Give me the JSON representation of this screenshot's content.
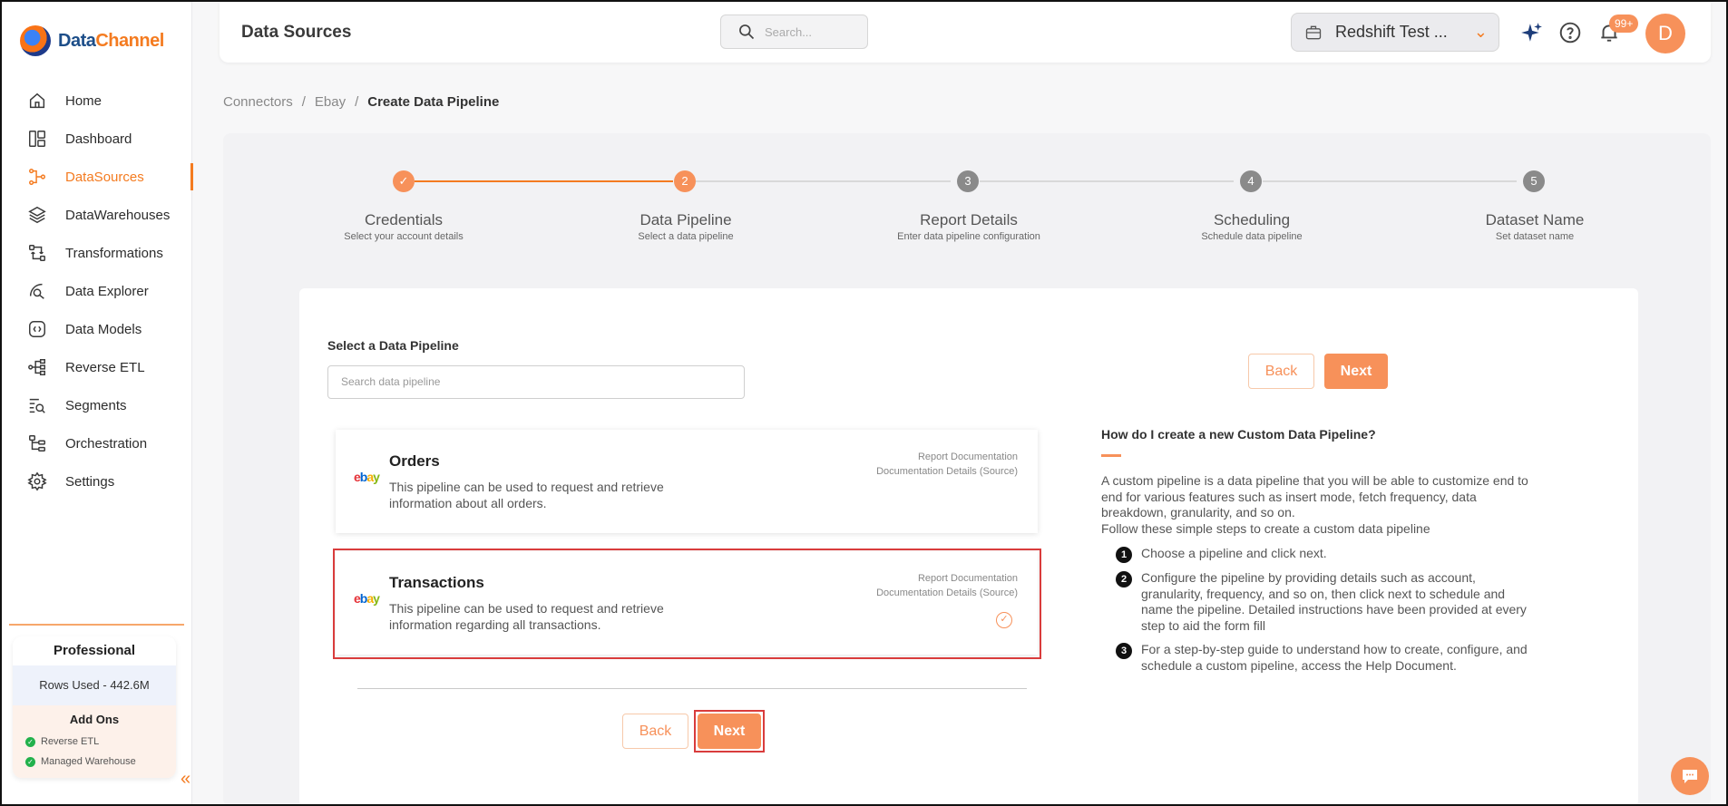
{
  "brand": {
    "name_part1": "Data",
    "name_part2": "Channel"
  },
  "sidebar": {
    "items": [
      {
        "label": "Home",
        "icon": "home-icon"
      },
      {
        "label": "Dashboard",
        "icon": "dashboard-icon"
      },
      {
        "label": "DataSources",
        "icon": "datasources-icon",
        "active": true
      },
      {
        "label": "DataWarehouses",
        "icon": "layers-icon"
      },
      {
        "label": "Transformations",
        "icon": "transformations-icon"
      },
      {
        "label": "Data Explorer",
        "icon": "explorer-icon"
      },
      {
        "label": "Data Models",
        "icon": "models-icon"
      },
      {
        "label": "Reverse ETL",
        "icon": "reverse-etl-icon"
      },
      {
        "label": "Segments",
        "icon": "segments-icon"
      },
      {
        "label": "Orchestration",
        "icon": "orchestration-icon"
      },
      {
        "label": "Settings",
        "icon": "gear-icon"
      }
    ],
    "plan": {
      "title": "Professional",
      "rows_used": "Rows Used - 442.6M",
      "addons_title": "Add Ons",
      "addons": [
        "Reverse ETL",
        "Managed Warehouse"
      ]
    }
  },
  "header": {
    "title": "Data Sources",
    "search_placeholder": "Search...",
    "workspace": "Redshift Test ...",
    "notification_count": "99+",
    "avatar_initial": "D"
  },
  "breadcrumb": {
    "items": [
      "Connectors",
      "Ebay"
    ],
    "separator": "/",
    "current": "Create Data Pipeline"
  },
  "stepper": {
    "steps": [
      {
        "number": "1",
        "label": "Credentials",
        "sub": "Select your account details",
        "state": "done"
      },
      {
        "number": "2",
        "label": "Data Pipeline",
        "sub": "Select a data pipeline",
        "state": "current"
      },
      {
        "number": "3",
        "label": "Report Details",
        "sub": "Enter data pipeline configuration",
        "state": "todo"
      },
      {
        "number": "4",
        "label": "Scheduling",
        "sub": "Schedule data pipeline",
        "state": "todo"
      },
      {
        "number": "5",
        "label": "Dataset Name",
        "sub": "Set dataset name",
        "state": "todo"
      }
    ]
  },
  "form": {
    "field_label": "Select a Data Pipeline",
    "search_placeholder": "Search data pipeline",
    "back_label": "Back",
    "next_label": "Next"
  },
  "pipelines": [
    {
      "name": "Orders",
      "logo": {
        "e": "e",
        "b": "b",
        "a": "a",
        "y": "y"
      },
      "description": "This pipeline can be used to request and retrieve information about all orders.",
      "link1": "Report Documentation",
      "link2": "Documentation Details (Source)",
      "selected": false
    },
    {
      "name": "Transactions",
      "logo": {
        "e": "e",
        "b": "b",
        "a": "a",
        "y": "y"
      },
      "description": "This pipeline can be used to request and retrieve information regarding all transactions.",
      "link1": "Report Documentation",
      "link2": "Documentation Details (Source)",
      "selected": true
    }
  ],
  "help": {
    "title": "How do I create a new Custom Data Pipeline?",
    "paragraph": "A custom pipeline is a data pipeline that you will be able to customize end to end for various features such as insert mode, fetch frequency, data breakdown, granularity, and so on.",
    "intro": "Follow these simple steps to create a custom data pipeline",
    "steps": [
      {
        "num": "1",
        "text": "Choose a pipeline and click next."
      },
      {
        "num": "2",
        "text": "Configure the pipeline by providing details such as account, granularity, frequency, and so on, then click next to schedule and name the pipeline. Detailed instructions have been provided at every step to aid the form fill"
      },
      {
        "num": "3",
        "text": "For a step-by-step guide to understand how to create, configure, and schedule a custom pipeline, access the Help Document."
      }
    ]
  },
  "colors": {
    "accent": "#f7915a",
    "brand_blue": "#1d4e89",
    "highlight": "#d93c3c"
  }
}
